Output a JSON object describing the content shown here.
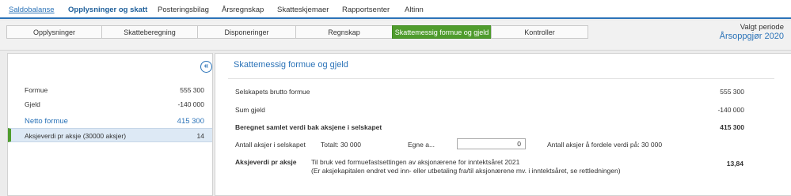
{
  "topnav": {
    "items": [
      "Saldobalanse",
      "Opplysninger og skatt",
      "Posteringsbilag",
      "Årsregnskap",
      "Skatteskjemaer",
      "Rapportsenter",
      "Altinn"
    ]
  },
  "tabs": [
    "Opplysninger",
    "Skatteberegning",
    "Disponeringer",
    "Regnskap",
    "Skattemessig formue og gjeld",
    "Kontroller"
  ],
  "period": {
    "label": "Valgt periode",
    "value": "Årsoppgjør 2020"
  },
  "sidebar": {
    "collapse_icon": "«",
    "rows": [
      {
        "label": "Formue",
        "value": "555 300"
      },
      {
        "label": "Gjeld",
        "value": "-140 000"
      },
      {
        "label": "Netto formue",
        "value": "415 300"
      },
      {
        "label": "Aksjeverdi pr aksje (30000 aksjer)",
        "value": "14"
      }
    ]
  },
  "main": {
    "title": "Skattemessig formue og gjeld",
    "rows": [
      {
        "label": "Selskapets brutto formue",
        "value": "555 300"
      },
      {
        "label": "Sum gjeld",
        "value": "-140 000"
      },
      {
        "label": "Beregnet samlet verdi bak aksjene i selskapet",
        "value": "415 300"
      }
    ],
    "shares": {
      "label": "Antall aksjer i selskapet",
      "total": "Totalt: 30 000",
      "own_label": "Egne a...",
      "own_value": "0",
      "distribute": "Antall aksjer å fordele verdi på: 30 000"
    },
    "per_share": {
      "label": "Aksjeverdi pr aksje",
      "note1": "Til bruk ved formuefastsettingen av aksjonærene for inntektsåret 2021",
      "note2": "(Er aksjekapitalen endret ved inn- eller utbetaling fra/til aksjonærene mv. i inntektsåret, se rettledningen)",
      "value": "13,84"
    }
  }
}
